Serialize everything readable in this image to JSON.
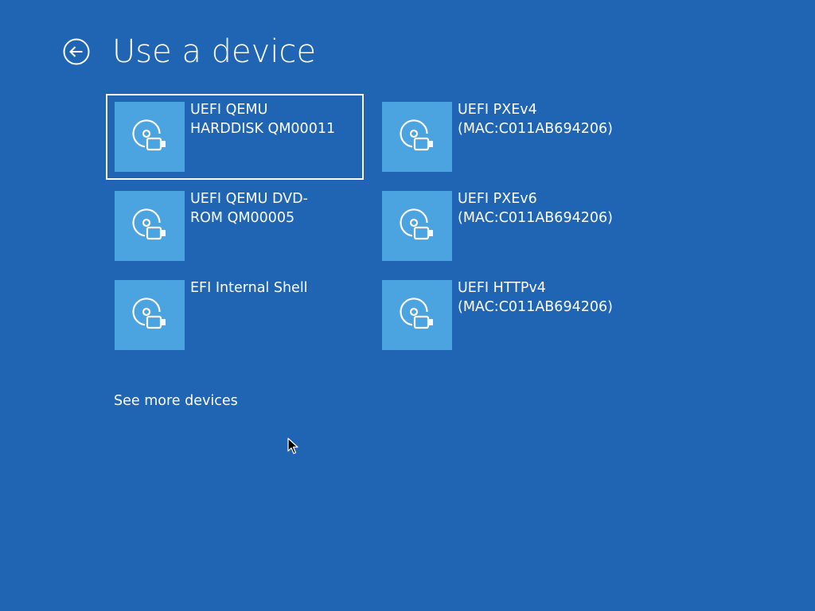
{
  "header": {
    "title": "Use a device",
    "back_icon": "back-arrow-circle-icon"
  },
  "devices": [
    {
      "label": "UEFI QEMU\nHARDDISK QM00011",
      "icon": "disc-usb-icon",
      "selected": true
    },
    {
      "label": "UEFI PXEv4\n(MAC:C011AB694206)",
      "icon": "disc-usb-icon",
      "selected": false
    },
    {
      "label": "UEFI QEMU DVD-\nROM QM00005",
      "icon": "disc-usb-icon",
      "selected": false
    },
    {
      "label": "UEFI PXEv6\n(MAC:C011AB694206)",
      "icon": "disc-usb-icon",
      "selected": false
    },
    {
      "label": "EFI Internal Shell",
      "icon": "disc-usb-icon",
      "selected": false
    },
    {
      "label": "UEFI HTTPv4\n(MAC:C011AB694206)",
      "icon": "disc-usb-icon",
      "selected": false
    }
  ],
  "footer": {
    "see_more_label": "See more devices"
  },
  "colors": {
    "background": "#1f65b3",
    "tile_icon_bg": "#4ba3df",
    "text": "#ffffff",
    "selection_border": "#ffffff"
  }
}
